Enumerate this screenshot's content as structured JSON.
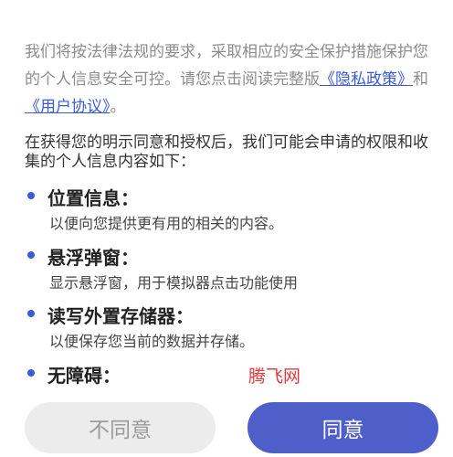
{
  "intro": {
    "text_before": "我们将按法律法规的要求，采取相应的安全保护措施保护您的个人信息安全可控。请您点击阅读完整版",
    "privacy_link": "《隐私政策》",
    "connector": "和",
    "agreement_link": "《用户协议》",
    "period": "。"
  },
  "lead": "在获得您的明示同意和授权后，我们可能会申请的权限和收集的个人信息内容如下：",
  "permissions": [
    {
      "title": "位置信息：",
      "desc": "以便向您提供更有用的相关的内容。"
    },
    {
      "title": "悬浮弹窗：",
      "desc": "显示悬浮窗，用于模拟器点击功能使用"
    },
    {
      "title": "读写外置存储器：",
      "desc": "以便保存您当前的数据并存储。"
    },
    {
      "title": "无障碍：",
      "desc": ""
    }
  ],
  "watermark": "腾飞网",
  "buttons": {
    "decline": "不同意",
    "agree": "同意"
  },
  "colors": {
    "link": "#3b5bd6",
    "agree_bg": "#4f5fc9",
    "decline_bg": "#ececec"
  }
}
